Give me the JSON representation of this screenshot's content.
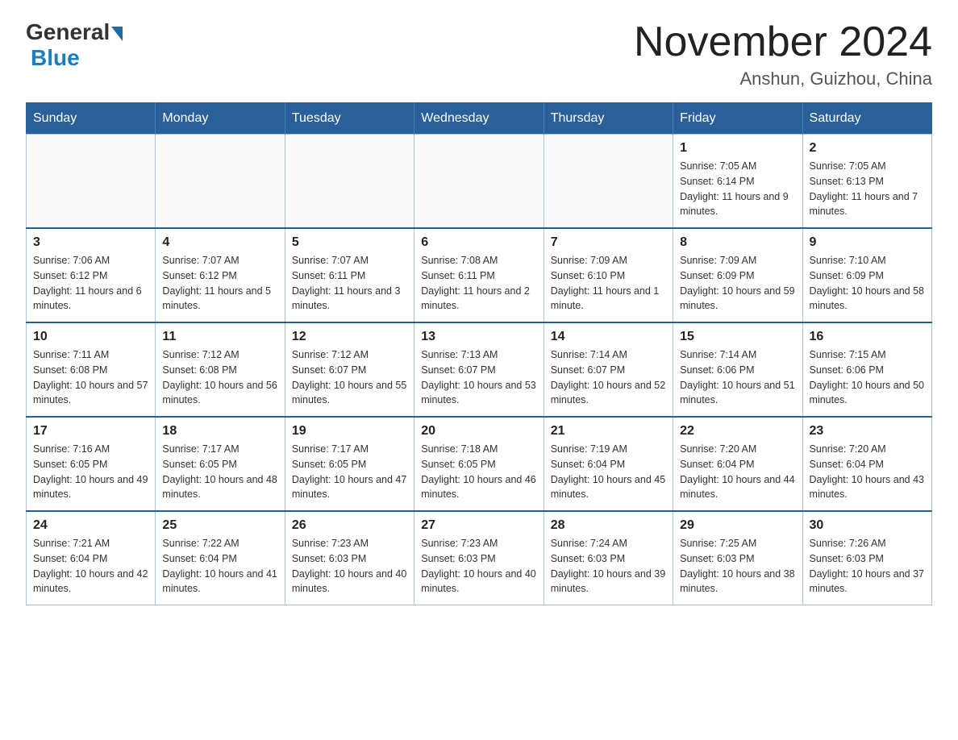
{
  "header": {
    "logo_general": "General",
    "logo_blue": "Blue",
    "month_title": "November 2024",
    "location": "Anshun, Guizhou, China"
  },
  "days_of_week": [
    "Sunday",
    "Monday",
    "Tuesday",
    "Wednesday",
    "Thursday",
    "Friday",
    "Saturday"
  ],
  "weeks": [
    {
      "cells": [
        {
          "day": "",
          "info": ""
        },
        {
          "day": "",
          "info": ""
        },
        {
          "day": "",
          "info": ""
        },
        {
          "day": "",
          "info": ""
        },
        {
          "day": "",
          "info": ""
        },
        {
          "day": "1",
          "info": "Sunrise: 7:05 AM\nSunset: 6:14 PM\nDaylight: 11 hours and 9 minutes."
        },
        {
          "day": "2",
          "info": "Sunrise: 7:05 AM\nSunset: 6:13 PM\nDaylight: 11 hours and 7 minutes."
        }
      ]
    },
    {
      "cells": [
        {
          "day": "3",
          "info": "Sunrise: 7:06 AM\nSunset: 6:12 PM\nDaylight: 11 hours and 6 minutes."
        },
        {
          "day": "4",
          "info": "Sunrise: 7:07 AM\nSunset: 6:12 PM\nDaylight: 11 hours and 5 minutes."
        },
        {
          "day": "5",
          "info": "Sunrise: 7:07 AM\nSunset: 6:11 PM\nDaylight: 11 hours and 3 minutes."
        },
        {
          "day": "6",
          "info": "Sunrise: 7:08 AM\nSunset: 6:11 PM\nDaylight: 11 hours and 2 minutes."
        },
        {
          "day": "7",
          "info": "Sunrise: 7:09 AM\nSunset: 6:10 PM\nDaylight: 11 hours and 1 minute."
        },
        {
          "day": "8",
          "info": "Sunrise: 7:09 AM\nSunset: 6:09 PM\nDaylight: 10 hours and 59 minutes."
        },
        {
          "day": "9",
          "info": "Sunrise: 7:10 AM\nSunset: 6:09 PM\nDaylight: 10 hours and 58 minutes."
        }
      ]
    },
    {
      "cells": [
        {
          "day": "10",
          "info": "Sunrise: 7:11 AM\nSunset: 6:08 PM\nDaylight: 10 hours and 57 minutes."
        },
        {
          "day": "11",
          "info": "Sunrise: 7:12 AM\nSunset: 6:08 PM\nDaylight: 10 hours and 56 minutes."
        },
        {
          "day": "12",
          "info": "Sunrise: 7:12 AM\nSunset: 6:07 PM\nDaylight: 10 hours and 55 minutes."
        },
        {
          "day": "13",
          "info": "Sunrise: 7:13 AM\nSunset: 6:07 PM\nDaylight: 10 hours and 53 minutes."
        },
        {
          "day": "14",
          "info": "Sunrise: 7:14 AM\nSunset: 6:07 PM\nDaylight: 10 hours and 52 minutes."
        },
        {
          "day": "15",
          "info": "Sunrise: 7:14 AM\nSunset: 6:06 PM\nDaylight: 10 hours and 51 minutes."
        },
        {
          "day": "16",
          "info": "Sunrise: 7:15 AM\nSunset: 6:06 PM\nDaylight: 10 hours and 50 minutes."
        }
      ]
    },
    {
      "cells": [
        {
          "day": "17",
          "info": "Sunrise: 7:16 AM\nSunset: 6:05 PM\nDaylight: 10 hours and 49 minutes."
        },
        {
          "day": "18",
          "info": "Sunrise: 7:17 AM\nSunset: 6:05 PM\nDaylight: 10 hours and 48 minutes."
        },
        {
          "day": "19",
          "info": "Sunrise: 7:17 AM\nSunset: 6:05 PM\nDaylight: 10 hours and 47 minutes."
        },
        {
          "day": "20",
          "info": "Sunrise: 7:18 AM\nSunset: 6:05 PM\nDaylight: 10 hours and 46 minutes."
        },
        {
          "day": "21",
          "info": "Sunrise: 7:19 AM\nSunset: 6:04 PM\nDaylight: 10 hours and 45 minutes."
        },
        {
          "day": "22",
          "info": "Sunrise: 7:20 AM\nSunset: 6:04 PM\nDaylight: 10 hours and 44 minutes."
        },
        {
          "day": "23",
          "info": "Sunrise: 7:20 AM\nSunset: 6:04 PM\nDaylight: 10 hours and 43 minutes."
        }
      ]
    },
    {
      "cells": [
        {
          "day": "24",
          "info": "Sunrise: 7:21 AM\nSunset: 6:04 PM\nDaylight: 10 hours and 42 minutes."
        },
        {
          "day": "25",
          "info": "Sunrise: 7:22 AM\nSunset: 6:04 PM\nDaylight: 10 hours and 41 minutes."
        },
        {
          "day": "26",
          "info": "Sunrise: 7:23 AM\nSunset: 6:03 PM\nDaylight: 10 hours and 40 minutes."
        },
        {
          "day": "27",
          "info": "Sunrise: 7:23 AM\nSunset: 6:03 PM\nDaylight: 10 hours and 40 minutes."
        },
        {
          "day": "28",
          "info": "Sunrise: 7:24 AM\nSunset: 6:03 PM\nDaylight: 10 hours and 39 minutes."
        },
        {
          "day": "29",
          "info": "Sunrise: 7:25 AM\nSunset: 6:03 PM\nDaylight: 10 hours and 38 minutes."
        },
        {
          "day": "30",
          "info": "Sunrise: 7:26 AM\nSunset: 6:03 PM\nDaylight: 10 hours and 37 minutes."
        }
      ]
    }
  ]
}
